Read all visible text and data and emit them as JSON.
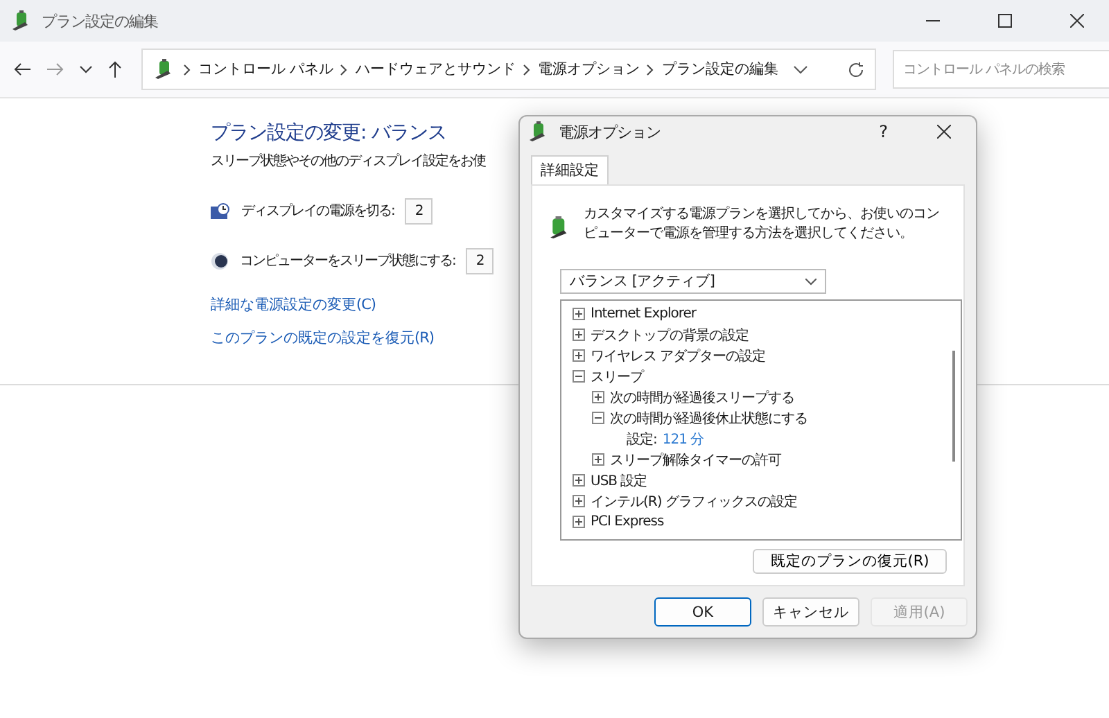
{
  "window": {
    "title": "プラン設定の編集"
  },
  "address_bar": {
    "crumbs": [
      "コントロール パネル",
      "ハードウェアとサウンド",
      "電源オプション",
      "プラン設定の編集"
    ]
  },
  "search": {
    "placeholder": "コントロール パネルの検索"
  },
  "main": {
    "heading": "プラン設定の変更: バランス",
    "description": "スリープ状態やその他のディスプレイ設定をお使",
    "settings": [
      {
        "kind": "display",
        "label": "ディスプレイの電源を切る:",
        "value": "2"
      },
      {
        "kind": "sleep",
        "label": "コンピューターをスリープ状態にする:",
        "value": "2"
      }
    ],
    "links": [
      "詳細な電源設定の変更(C)",
      "このプランの既定の設定を復元(R)"
    ]
  },
  "dialog": {
    "title": "電源オプション",
    "help": "?",
    "tabs": [
      {
        "label": "詳細設定",
        "selected": true
      }
    ],
    "description": "カスタマイズする電源プランを選択してから、お使いのコンピューターで電源を管理する方法を選択してください。",
    "plan_select": {
      "value": "バランス [アクティブ]"
    },
    "tree": [
      {
        "label": "Internet Explorer",
        "expanded": false
      },
      {
        "label": "デスクトップの背景の設定",
        "expanded": false
      },
      {
        "label": "ワイヤレス アダプターの設定",
        "expanded": false
      },
      {
        "label": "スリープ",
        "expanded": true,
        "children": [
          {
            "label": "次の時間が経過後スリープする",
            "expanded": false
          },
          {
            "label": "次の時間が経過後休止状態にする",
            "expanded": true,
            "children": [
              {
                "kind": "setting",
                "label": "設定:",
                "value": "121 分"
              }
            ]
          },
          {
            "label": "スリープ解除タイマーの許可",
            "expanded": false
          }
        ]
      },
      {
        "label": "USB 設定",
        "expanded": false
      },
      {
        "label": "インテル(R) グラフィックスの設定",
        "expanded": false
      },
      {
        "label": "PCI Express",
        "expanded": false
      }
    ],
    "restore_button": "既定のプランの復元(R)",
    "buttons": [
      {
        "label": "OK",
        "disabled": false
      },
      {
        "label": "キャンセル",
        "disabled": false
      },
      {
        "label": "適用(A)",
        "disabled": true
      }
    ]
  }
}
